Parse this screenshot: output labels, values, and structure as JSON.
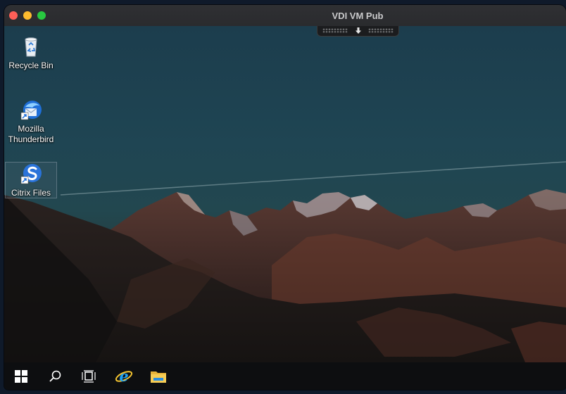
{
  "window": {
    "title": "VDI VM Pub"
  },
  "desktop_icons": [
    {
      "label": "Recycle Bin"
    },
    {
      "label": "Mozilla Thunderbird"
    },
    {
      "label": "Citrix Files"
    }
  ],
  "taskbar": {
    "items": [
      "start-icon",
      "search-icon",
      "task-view-icon",
      "internet-explorer-icon",
      "file-explorer-icon"
    ]
  }
}
